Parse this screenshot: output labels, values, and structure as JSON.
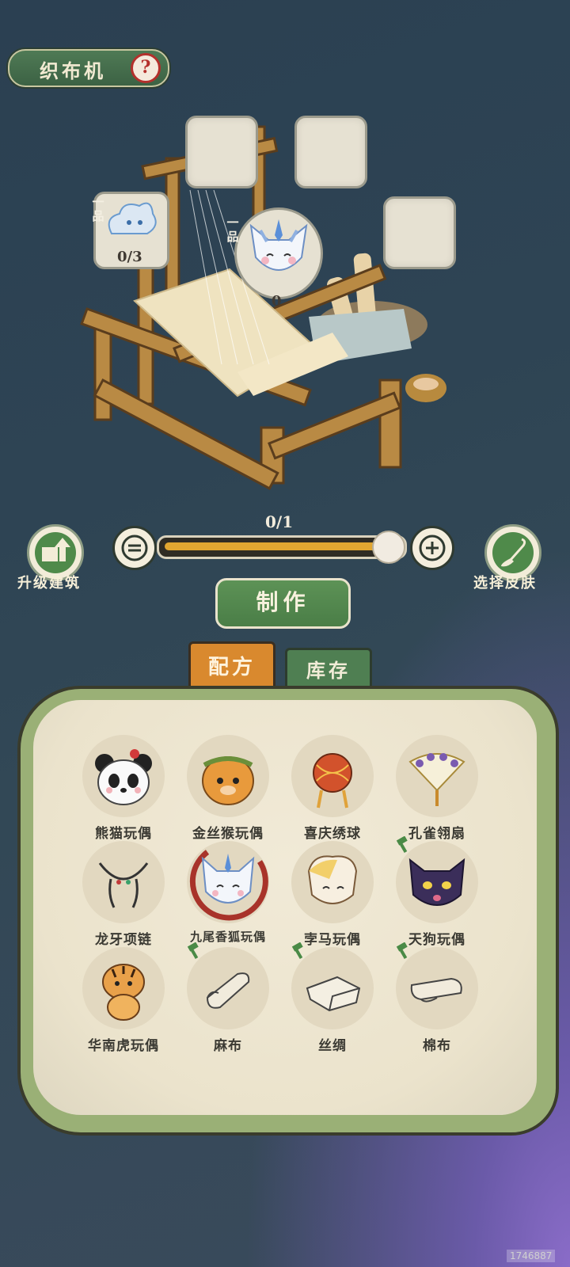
{
  "header": {
    "title": "织布机",
    "help_icon": "question-mark"
  },
  "loom": {
    "fabric_slot": {
      "grade": "一品",
      "count": "0/3"
    },
    "doll_slot": {
      "grade": "一品",
      "count": "0"
    }
  },
  "slider": {
    "count": "0/1",
    "fill_fraction": 1.0
  },
  "actions": {
    "upgrade_label": "升级建筑",
    "skin_label": "选择皮肤",
    "make_label": "制作"
  },
  "tabs": [
    {
      "label": "配方",
      "active": true
    },
    {
      "label": "库存",
      "active": false
    }
  ],
  "recipes": [
    {
      "label": "熊猫玩偶",
      "icon": "panda-doll",
      "locked": false,
      "selected": false
    },
    {
      "label": "金丝猴玩偶",
      "icon": "golden-monkey-doll",
      "locked": false,
      "selected": false
    },
    {
      "label": "喜庆绣球",
      "icon": "embroidered-ball",
      "locked": false,
      "selected": false
    },
    {
      "label": "孔雀翎扇",
      "icon": "peacock-fan",
      "locked": false,
      "selected": false
    },
    {
      "label": "龙牙项链",
      "icon": "dragon-tooth-necklace",
      "locked": false,
      "selected": false
    },
    {
      "label": "九尾香狐玩偶",
      "icon": "nine-tailed-fox-doll",
      "locked": false,
      "selected": true
    },
    {
      "label": "孛马玩偶",
      "icon": "horse-doll",
      "locked": false,
      "selected": false
    },
    {
      "label": "天狗玩偶",
      "icon": "tiangou-doll",
      "locked": true,
      "selected": false
    },
    {
      "label": "华南虎玩偶",
      "icon": "south-china-tiger-doll",
      "locked": false,
      "selected": false
    },
    {
      "label": "麻布",
      "icon": "linen-cloth",
      "locked": true,
      "selected": false
    },
    {
      "label": "丝绸",
      "icon": "silk-cloth",
      "locked": true,
      "selected": false
    },
    {
      "label": "棉布",
      "icon": "cotton-cloth",
      "locked": true,
      "selected": false
    }
  ],
  "watermark": "1746887",
  "colors": {
    "accent_orange": "#d9892e",
    "accent_green": "#4f7f52",
    "slider_fill": "#e1a631",
    "selected_ring": "#a8332a"
  }
}
